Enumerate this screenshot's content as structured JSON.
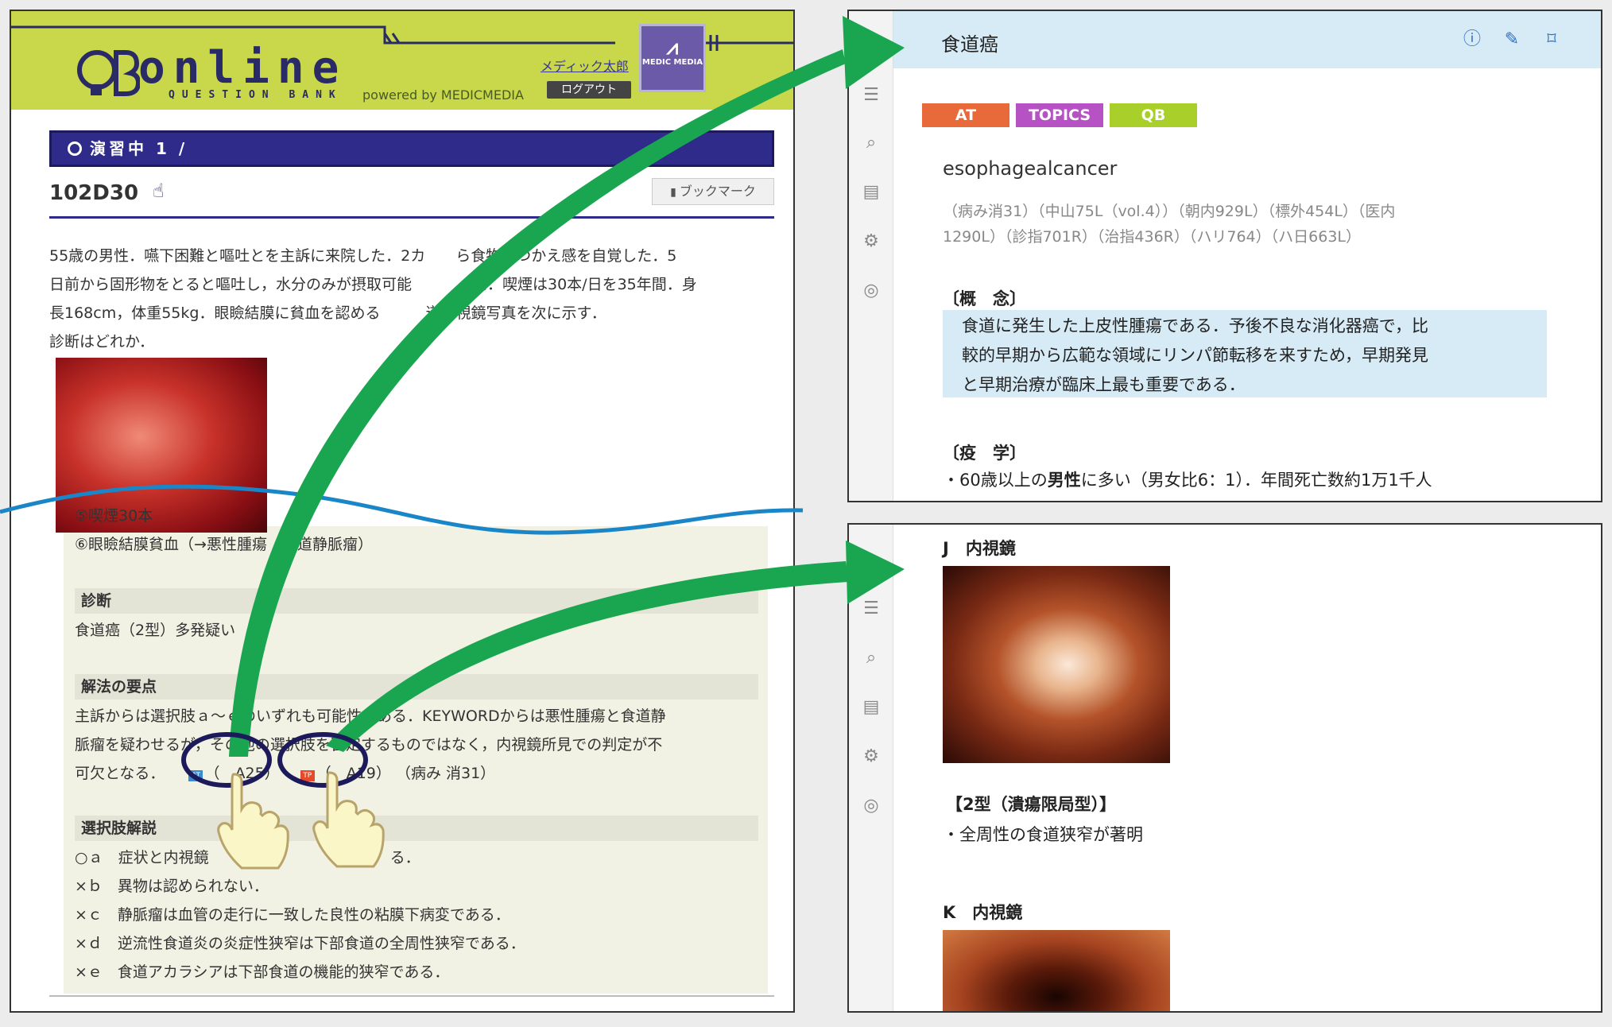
{
  "left": {
    "header": {
      "logo_text": "onine",
      "logo_text_full": "online",
      "logo_qb": "QB",
      "tagline": "QUESTION BANK",
      "powered_by": "powered by MEDICMEDIA",
      "user_name": "メディック太郎",
      "logout_label": "ログアウト",
      "medic_logo_text": "MEDIC MEDIA"
    },
    "progress_label": "演習中 1 /",
    "question_id": "102D30",
    "bookmark_label": "ブックマーク",
    "question_lines": [
      "55歳の男性．嚥下困難と嘔吐とを主訴に来院した．2カ　　ら食物のつかえ感を自覚した．5",
      "日前から固形物をとると嘔吐し，水分のみが摂取可能　　　った．喫煙は30本/日を35年間．身",
      "長168cm，体重55kg．眼瞼結膜に貧血を認める　　　道内視鏡写真を次に示す．",
      "診断はどれか．"
    ],
    "keywords": {
      "k5": "⑤喫煙30本",
      "k6": "⑥眼瞼結膜貧血（→悪性腫瘍　食道静脈瘤）"
    },
    "diagnosis_heading": "診断",
    "diagnosis_text": "食道癌（2型）多発疑い",
    "key_points_heading": "解法の要点",
    "key_points_line1": "主訴からは選択肢ａ～ｅのいずれも可能性がある．KEYWORDからは悪性腫瘍と食道静",
    "key_points_line2": "脈瘤を疑わせるが，その他の選択肢を否定するものではなく，内視鏡所見での判定が不",
    "key_points_line3_prefix": "可欠となる．",
    "ref_at": "（　A25）",
    "ref_at_icon": "AT",
    "ref_tp": "（　A19）",
    "ref_tp_icon": "TP",
    "ref_byomi": "（病み 消31）",
    "choices_heading": "選択肢解説",
    "choices": [
      "○ａ　症状と内視鏡　　　　　　　　　　　　る．",
      "×ｂ　異物は認められない．",
      "×ｃ　静脈瘤は血管の走行に一致した良性の粘膜下病変である．",
      "×ｄ　逆流性食道炎の炎症性狭窄は下部食道の全周性狭窄である．",
      "×ｅ　食道アカラシアは下部食道の機能的狭窄である．"
    ]
  },
  "right_top": {
    "title": "食道癌",
    "tags": [
      "AT",
      "TOPICS",
      "QB"
    ],
    "english_name": "esophagealcancer",
    "ref_books_line1": "（病み消31）（中山75L（vol.4））（朝内929L）（標外454L）（医内",
    "ref_books_line2": "1290L）（診指701R）（治指436R）（ハリ764）（ハ日663L）",
    "concept_heading": "〔概　念〕",
    "concept_lines": [
      "食道に発生した上皮性腫瘍である．予後不良な消化器癌で，比",
      "較的早期から広範な領域にリンパ節転移を来すため，早期発見",
      "と早期治療が臨床上最も重要である．"
    ],
    "epidemiology_heading": "〔疫　学〕",
    "epidemiology_text_pre": "・60歳以上の",
    "epidemiology_text_bold": "男性",
    "epidemiology_text_post": "に多い（男女比6：1）．年間死亡数約1万1千人",
    "icons": [
      "info-icon",
      "edit-icon",
      "bookmark-icon"
    ]
  },
  "right_bottom": {
    "section_j": "J　内視鏡",
    "type2_heading": "【2型（潰瘍限局型）】",
    "type2_text": "・全周性の食道狭窄が著明",
    "section_k": "K　内視鏡"
  },
  "rail_icons": [
    "list-icon",
    "search-icon",
    "document-icon",
    "settings-icon",
    "qb-icon"
  ],
  "colors": {
    "header_green": "#c8d84a",
    "navy": "#2e2b8a",
    "arrow_green": "#1aa650",
    "wave_blue": "#1a86c8",
    "article_header_blue": "#d7ebf6",
    "tag_at": "#e8693a",
    "tag_topics": "#b652c4",
    "tag_qb": "#a8cf2a"
  }
}
